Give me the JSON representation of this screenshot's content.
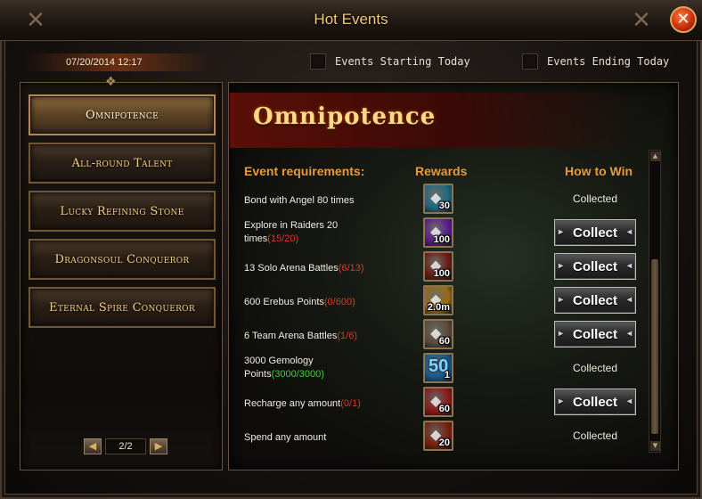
{
  "window": {
    "title": "Hot Events",
    "close_label": "✕"
  },
  "header": {
    "date": "07/20/2014 12:17",
    "filter_starting": "Events Starting Today",
    "filter_ending": "Events Ending Today"
  },
  "events": [
    {
      "label": "Omnipotence",
      "active": true
    },
    {
      "label": "All-round Talent",
      "active": false
    },
    {
      "label": "Lucky Refining Stone",
      "active": false
    },
    {
      "label": "Dragonsoul Conqueror",
      "active": false
    },
    {
      "label": "Eternal Spire Conqueror",
      "active": false
    }
  ],
  "pager": {
    "label": "2/2",
    "prev": "◀",
    "next": "▶"
  },
  "detail": {
    "title": "Omnipotence",
    "col_requirements": "Event requirements:",
    "col_rewards": "Rewards",
    "col_howtowin": "How to Win",
    "rows": [
      {
        "req": "Bond with Angel 80 times",
        "progress": "",
        "reward_qty": "30",
        "reward_icon": "angel-feather-icon",
        "status": "Collected",
        "color": "#1f6a80"
      },
      {
        "req": "Explore in Raiders 20 times",
        "progress": "(15/20)",
        "reward_qty": "100",
        "reward_icon": "purple-orb-icon",
        "status": "Collect",
        "color": "#5a1c8a"
      },
      {
        "req": "13 Solo Arena Battles",
        "progress": "(6/13)",
        "reward_qty": "100",
        "reward_icon": "crossed-swords-icon",
        "status": "Collect",
        "color": "#6a1a14"
      },
      {
        "req": "600 Erebus Points",
        "progress": "(0/600)",
        "reward_qty": "2.0m",
        "reward_icon": "gold-coin-icon",
        "status": "Collect",
        "color": "#9a6a12"
      },
      {
        "req": "6 Team Arena Battles",
        "progress": "(1/6)",
        "reward_qty": "60",
        "reward_icon": "pearl-icon",
        "status": "Collect",
        "color": "#5a4a3a"
      },
      {
        "req": "3000 Gemology Points",
        "progress": "(3000/3000)",
        "reward_qty": "1",
        "reward_icon": "level-50-gem-icon",
        "status": "Collected",
        "color": "#1a5a8a",
        "big": "50"
      },
      {
        "req": "Recharge any amount",
        "progress": "(0/1)",
        "reward_qty": "60",
        "reward_icon": "red-crystal-icon",
        "status": "Collect",
        "color": "#8a1a1a"
      },
      {
        "req": "Spend any amount",
        "progress": "",
        "reward_qty": "20",
        "reward_icon": "scroll-icon",
        "status": "Collected",
        "color": "#7a2010"
      }
    ]
  }
}
